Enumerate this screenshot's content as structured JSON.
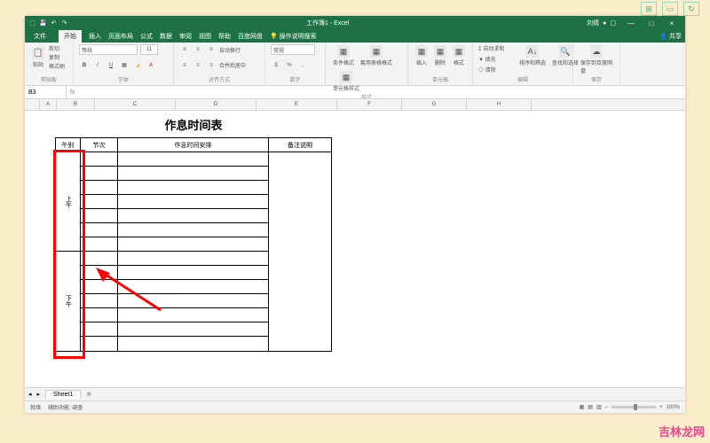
{
  "titlebar": {
    "title": "工作簿1 - Excel",
    "username": "刘倩",
    "min": "—",
    "max": "□",
    "close": "×"
  },
  "menu": {
    "file": "文件",
    "home": "开始",
    "insert": "插入",
    "layout": "页面布局",
    "formula": "公式",
    "data": "数据",
    "review": "审阅",
    "view": "视图",
    "help": "帮助",
    "baidu": "百度网盘",
    "tell": "操作说明搜索",
    "share": "共享"
  },
  "ribbon": {
    "clipboard": {
      "paste": "粘贴",
      "cut": "剪切",
      "copy": "复制",
      "painter": "格式刷",
      "label": "剪贴板"
    },
    "font": {
      "name": "等线",
      "size": "11",
      "label": "字体"
    },
    "align": {
      "wrap": "自动换行",
      "merge": "合并后居中",
      "label": "对齐方式"
    },
    "number": {
      "format": "常规",
      "label": "数字"
    },
    "styles": {
      "cond": "条件格式",
      "table": "套用表格格式",
      "cell": "单元格样式",
      "label": "样式"
    },
    "cells": {
      "insert": "插入",
      "delete": "删除",
      "format": "格式",
      "label": "单元格"
    },
    "editing": {
      "sum": "自动求和",
      "fill": "填充",
      "clear": "清除",
      "sort": "排序和筛选",
      "find": "查找和选择",
      "label": "编辑"
    },
    "save": {
      "save": "保存到百度网盘",
      "label": "保存"
    }
  },
  "namebox": "B3",
  "columns": [
    "A",
    "B",
    "C",
    "D",
    "E",
    "F",
    "G",
    "H"
  ],
  "schedule": {
    "title": "作息时间表",
    "h1": "午别",
    "h2": "节次",
    "h3": "作息时间安排",
    "h4": "备注说明",
    "morning": "上午",
    "afternoon": "下午"
  },
  "sheet": {
    "name": "Sheet1"
  },
  "status": {
    "ready": "就绪",
    "acc": "辅助功能: 调查",
    "zoom": "100%"
  },
  "watermark": "吉林龙网"
}
